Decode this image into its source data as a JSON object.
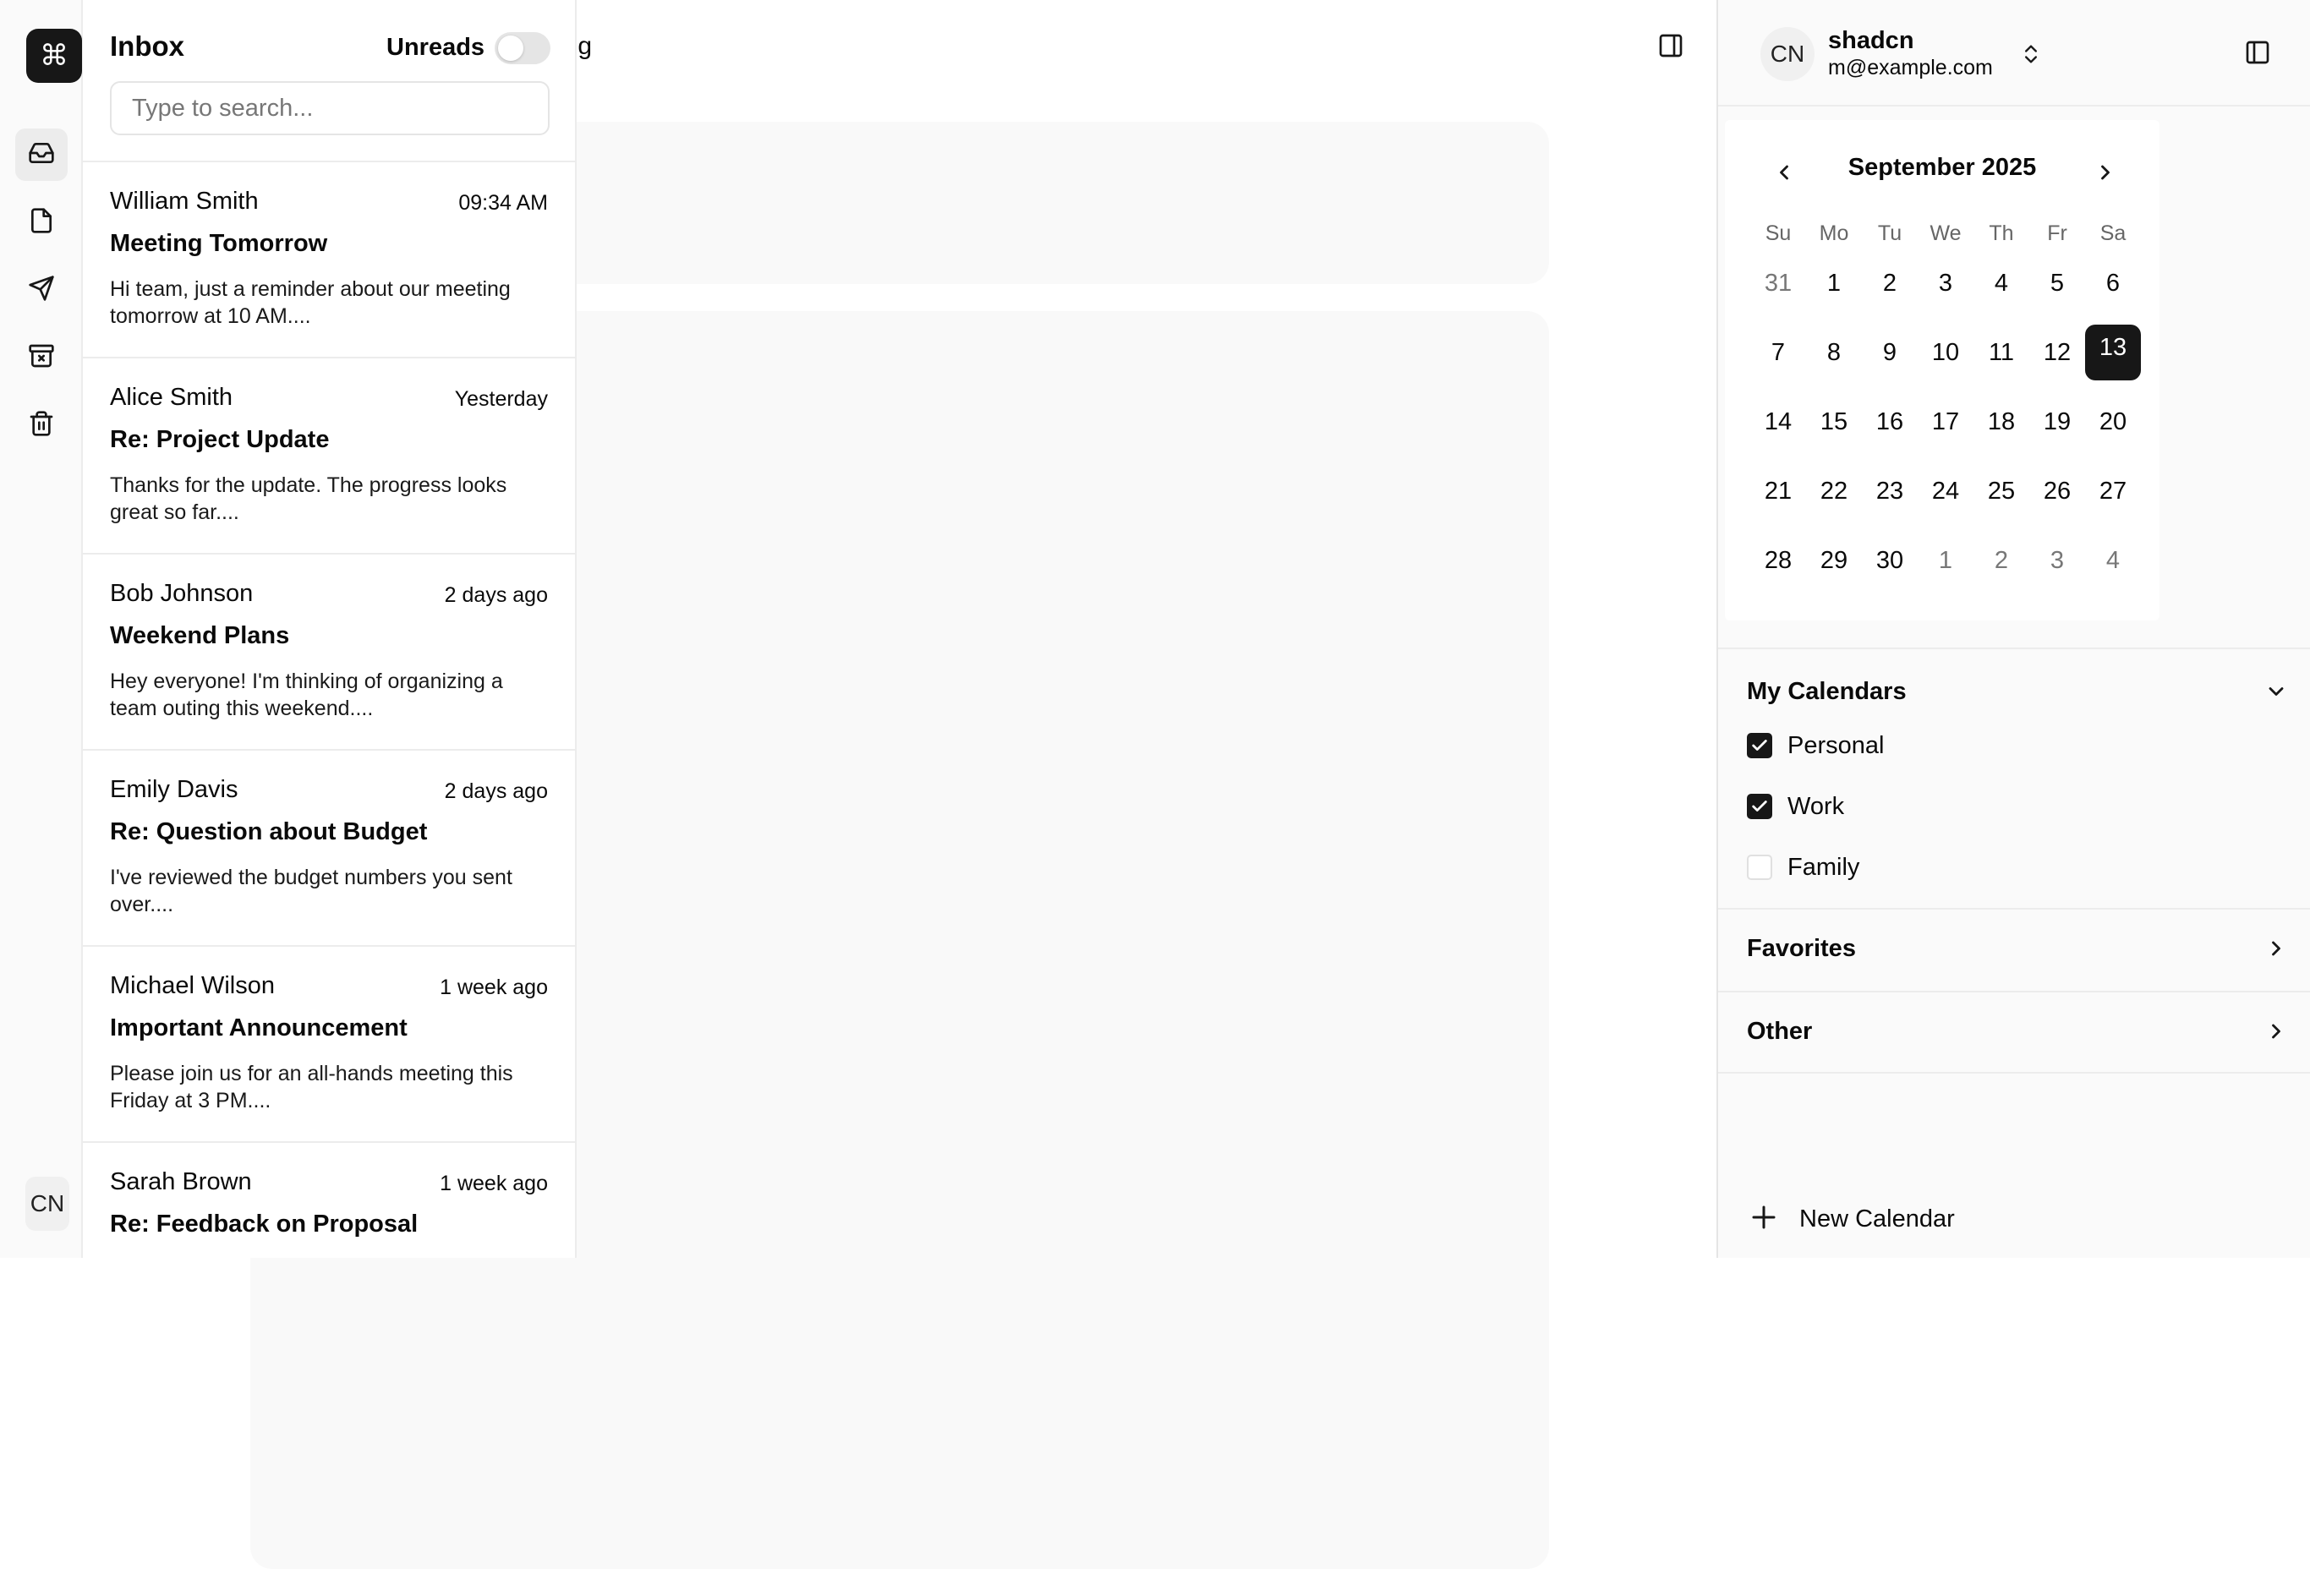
{
  "main": {
    "breadcrumb_tail": "ing"
  },
  "rail": {
    "logo_icon": "command-icon",
    "items": [
      {
        "icon": "inbox-icon",
        "active": true
      },
      {
        "icon": "file-icon",
        "active": false
      },
      {
        "icon": "send-icon",
        "active": false
      },
      {
        "icon": "archive-x-icon",
        "active": false
      },
      {
        "icon": "trash-icon",
        "active": false
      }
    ],
    "avatar": "CN"
  },
  "inbox": {
    "title": "Inbox",
    "unreads_label": "Unreads",
    "search_placeholder": "Type to search...",
    "mails": [
      {
        "from": "William Smith",
        "time": "09:34 AM",
        "subject": "Meeting Tomorrow",
        "preview": "Hi team, just a reminder about our meeting tomorrow at 10 AM...."
      },
      {
        "from": "Alice Smith",
        "time": "Yesterday",
        "subject": "Re: Project Update",
        "preview": "Thanks for the update. The progress looks great so far...."
      },
      {
        "from": "Bob Johnson",
        "time": "2 days ago",
        "subject": "Weekend Plans",
        "preview": "Hey everyone! I'm thinking of organizing a team outing this weekend...."
      },
      {
        "from": "Emily Davis",
        "time": "2 days ago",
        "subject": "Re: Question about Budget",
        "preview": "I've reviewed the budget numbers you sent over...."
      },
      {
        "from": "Michael Wilson",
        "time": "1 week ago",
        "subject": "Important Announcement",
        "preview": "Please join us for an all-hands meeting this Friday at 3 PM...."
      },
      {
        "from": "Sarah Brown",
        "time": "1 week ago",
        "subject": "Re: Feedback on Proposal",
        "preview": ""
      }
    ]
  },
  "user": {
    "avatar": "CN",
    "name": "shadcn",
    "email": "m@example.com"
  },
  "calendar": {
    "month_label": "September 2025",
    "weekdays": [
      "Su",
      "Mo",
      "Tu",
      "We",
      "Th",
      "Fr",
      "Sa"
    ],
    "weeks": [
      [
        "31",
        "1",
        "2",
        "3",
        "4",
        "5",
        "6"
      ],
      [
        "7",
        "8",
        "9",
        "10",
        "11",
        "12",
        "13"
      ],
      [
        "14",
        "15",
        "16",
        "17",
        "18",
        "19",
        "20"
      ],
      [
        "21",
        "22",
        "23",
        "24",
        "25",
        "26",
        "27"
      ],
      [
        "28",
        "29",
        "30",
        "1",
        "2",
        "3",
        "4"
      ]
    ],
    "muted": [
      [
        0,
        0
      ],
      [
        4,
        3
      ],
      [
        4,
        4
      ],
      [
        4,
        5
      ],
      [
        4,
        6
      ]
    ],
    "selected": [
      1,
      6
    ]
  },
  "calendars": {
    "my_calendars_title": "My Calendars",
    "items": [
      {
        "label": "Personal",
        "checked": true
      },
      {
        "label": "Work",
        "checked": true
      },
      {
        "label": "Family",
        "checked": false
      }
    ],
    "favorites_title": "Favorites",
    "other_title": "Other",
    "new_calendar_label": "New Calendar"
  }
}
